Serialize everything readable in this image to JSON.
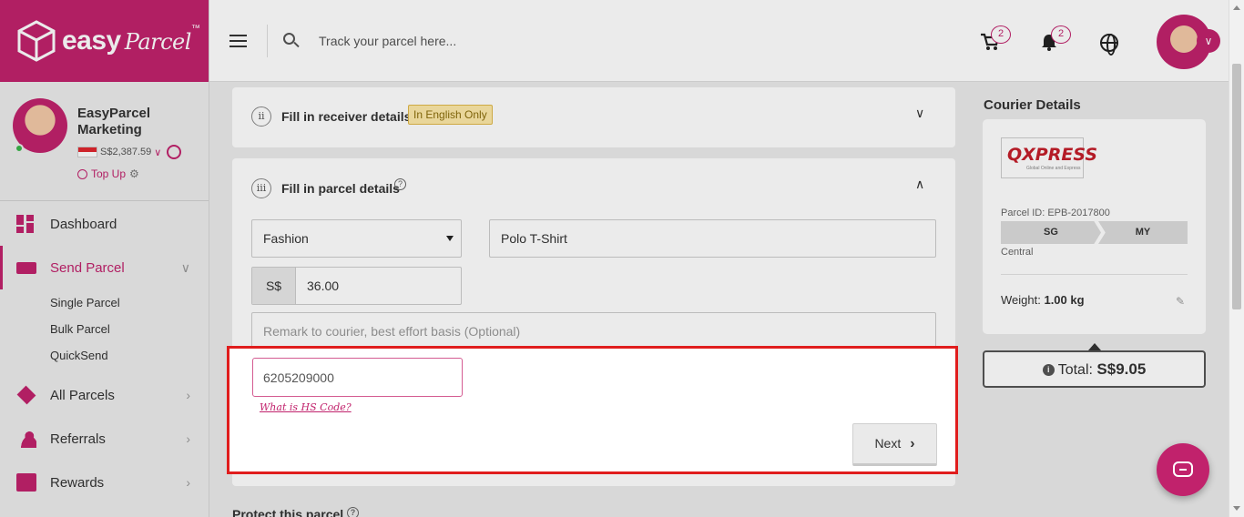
{
  "brand": {
    "logo_text": "easy",
    "logo_script": "Parcel",
    "tm": "™",
    "accent": "#c1226c"
  },
  "topbar": {
    "search_placeholder": "Track your parcel here...",
    "cart_count": "2",
    "notif_count": "2"
  },
  "profile": {
    "name": "EasyParcel Marketing",
    "balance": "S$2,387.59",
    "topup": "Top Up"
  },
  "sidebar": {
    "items": [
      {
        "label": "Dashboard"
      },
      {
        "label": "Send Parcel"
      },
      {
        "label": "All Parcels"
      },
      {
        "label": "Referrals"
      },
      {
        "label": "Rewards"
      }
    ],
    "sub_items": [
      {
        "label": "Single Parcel"
      },
      {
        "label": "Bulk Parcel"
      },
      {
        "label": "QuickSend"
      }
    ]
  },
  "steps": {
    "receiver": {
      "num": "ii",
      "title": "Fill in receiver details",
      "tag": "In English Only"
    },
    "parcel": {
      "num": "iii",
      "title": "Fill in parcel details"
    }
  },
  "form": {
    "category": "Fashion",
    "description": "Polo T-Shirt",
    "currency": "S$",
    "value": "36.00",
    "remark_placeholder": "Remark to courier, best effort basis (Optional)",
    "hs_code": "6205209000",
    "hs_link": "What is HS Code?",
    "next_label": "Next"
  },
  "courier": {
    "section_title": "Courier Details",
    "logo_main": "QXPRESS",
    "logo_sub": "Global Online and Express",
    "parcel_id": "Parcel ID: EPB-2017800",
    "from": "SG",
    "to": "MY",
    "region": "Central",
    "weight_label": "Weight:",
    "weight_value": "1.00 kg",
    "total_label": "Total:",
    "total_value": "S$9.05"
  },
  "protect": {
    "title": "Protect this parcel"
  }
}
